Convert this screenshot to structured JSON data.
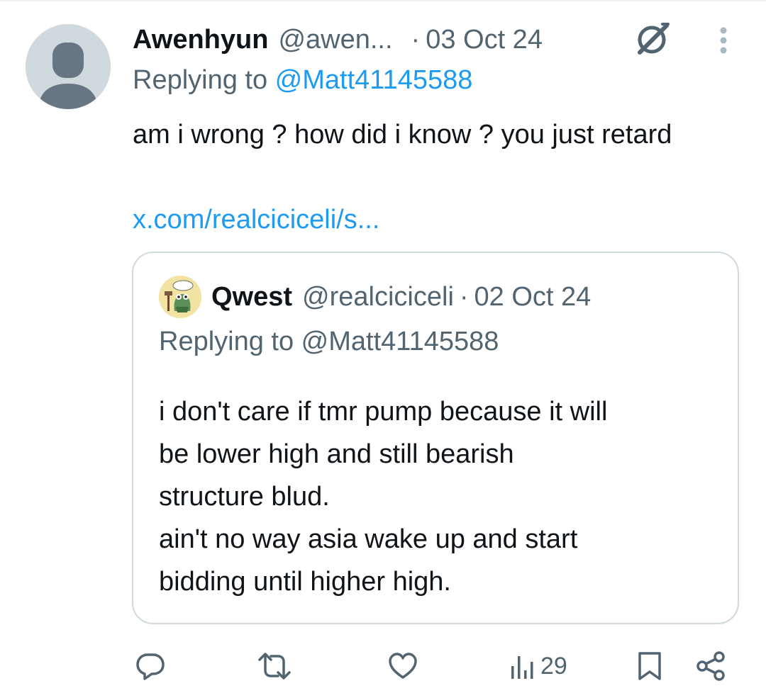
{
  "tweet": {
    "author_name": "Awenhyun",
    "author_handle": "@awen...",
    "separator": "·",
    "date": "03 Oct 24",
    "replying_prefix": "Replying to ",
    "replying_to": "@Matt41145588",
    "text": "am i wrong ? how did i know ? you just retard",
    "link": "x.com/realciciceli/s..."
  },
  "quote": {
    "author_name": "Qwest",
    "author_handle": "@realciciceli",
    "separator": "·",
    "date": "02 Oct 24",
    "replying_text": "Replying to @Matt41145588",
    "lines": [
      "i don't care if tmr pump because it will",
      "be lower high and still bearish",
      "structure blud.",
      "ain't no way asia wake up and start",
      "bidding until higher high."
    ]
  },
  "actions": {
    "views_count": "29",
    "icons": [
      "reply-icon",
      "retweet-icon",
      "like-icon",
      "views-icon",
      "bookmark-icon",
      "share-icon"
    ]
  },
  "colors": {
    "text": "#0f1419",
    "secondary": "#536471",
    "accent": "#1d9bf0",
    "border": "#cfd9de",
    "avatar_bg": "#cfd9de",
    "avatar_fg": "#687684"
  }
}
